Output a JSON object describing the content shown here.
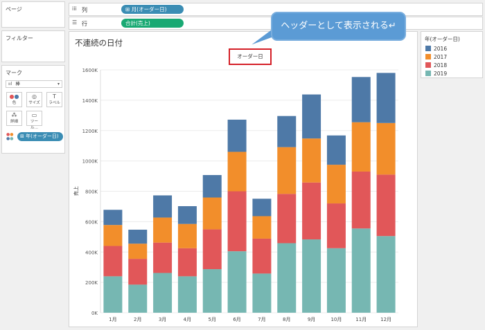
{
  "left_panel": {
    "pages_title": "ページ",
    "filters_title": "フィルター",
    "marks": {
      "title": "マーク",
      "mark_type": "棒",
      "buttons": [
        {
          "label": "色",
          "icon": "color-dots-icon"
        },
        {
          "label": "サイズ",
          "icon": "size-icon"
        },
        {
          "label": "ラベル",
          "icon": "label-icon"
        },
        {
          "label": "詳細",
          "icon": "detail-icon"
        },
        {
          "label": "ツール…",
          "icon": "tooltip-icon"
        }
      ],
      "color_pill": "年(オーダー日)"
    }
  },
  "shelves": {
    "columns": {
      "label": "列",
      "pill": "月(オーダー日)",
      "pill_color": "#3b8db4"
    },
    "rows": {
      "label": "行",
      "pill": "合計(売上)",
      "pill_color": "#19a973"
    }
  },
  "callout": {
    "text": "ヘッダーとして表示される↵"
  },
  "viz": {
    "title": "不連続の日付",
    "header": "オーダー日"
  },
  "legend": {
    "title": "年(オーダー日)",
    "items": [
      {
        "label": "2016",
        "color": "#4e79a7"
      },
      {
        "label": "2017",
        "color": "#f28e2b"
      },
      {
        "label": "2018",
        "color": "#e15759"
      },
      {
        "label": "2019",
        "color": "#76b7b2"
      }
    ]
  },
  "chart_data": {
    "type": "bar",
    "stacked": true,
    "categories": [
      "1月",
      "2月",
      "3月",
      "4月",
      "5月",
      "6月",
      "7月",
      "8月",
      "9月",
      "10月",
      "11月",
      "12月"
    ],
    "ylabel": "売上",
    "ylim": [
      0,
      1600000
    ],
    "yticks": [
      "0K",
      "200K",
      "400K",
      "600K",
      "800K",
      "1000K",
      "1200K",
      "1400K",
      "1600K"
    ],
    "series": [
      {
        "name": "2019",
        "color": "#76b7b2",
        "values": [
          240000,
          185000,
          262000,
          240000,
          287000,
          405000,
          258000,
          458000,
          483000,
          425000,
          555000,
          505000
        ]
      },
      {
        "name": "2018",
        "color": "#e15759",
        "values": [
          200000,
          170000,
          200000,
          185000,
          262000,
          395000,
          230000,
          325000,
          375000,
          295000,
          375000,
          405000
        ]
      },
      {
        "name": "2017",
        "color": "#f28e2b",
        "values": [
          138000,
          100000,
          165000,
          160000,
          210000,
          260000,
          148000,
          308000,
          290000,
          255000,
          325000,
          340000
        ]
      },
      {
        "name": "2016",
        "color": "#4e79a7",
        "values": [
          100000,
          92000,
          146000,
          117000,
          148000,
          212000,
          115000,
          205000,
          290000,
          193000,
          298000,
          330000
        ]
      }
    ]
  }
}
